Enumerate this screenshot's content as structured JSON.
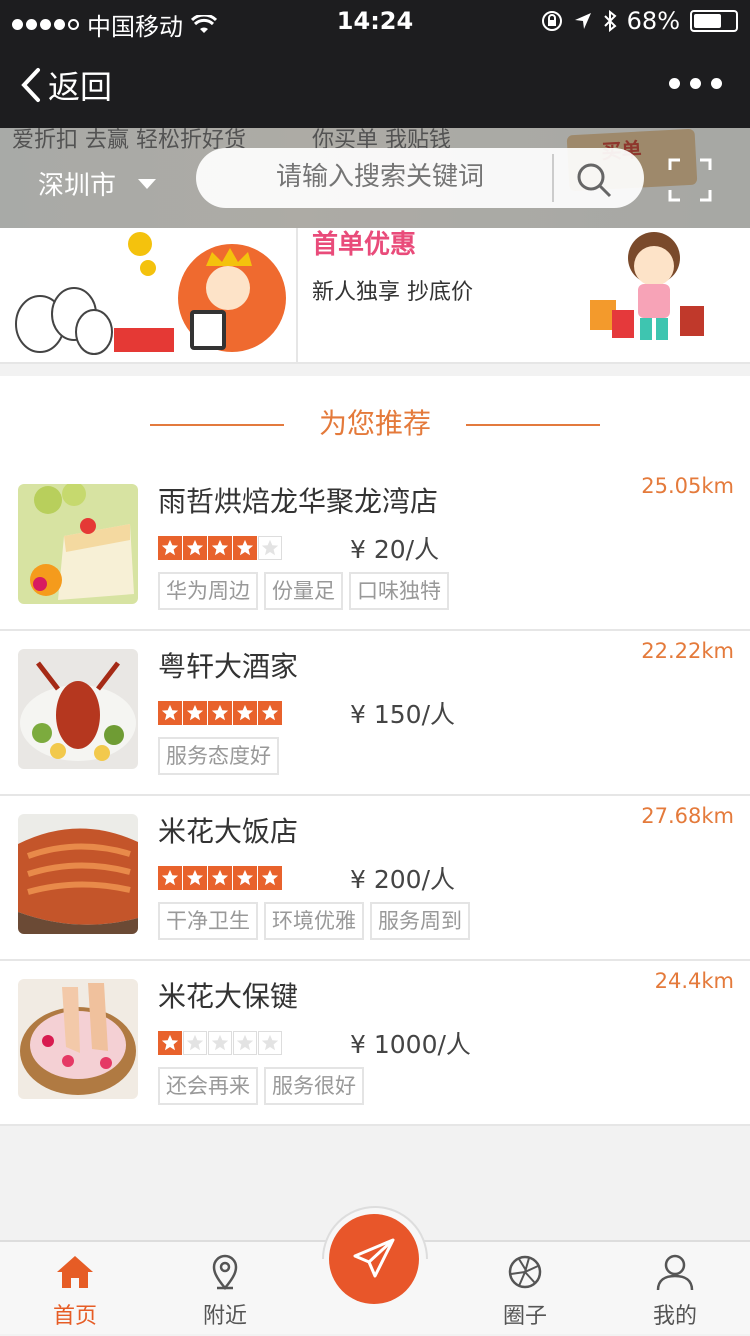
{
  "status": {
    "carrier": "中国移动",
    "time": "14:24",
    "battery": "68%",
    "battery_level": 0.68
  },
  "nav": {
    "back_label": "返回"
  },
  "banner": {
    "text_left": "爱折扣 去赢 轻松折好货",
    "text_right": "你买单 我贴钱",
    "sign": "买单"
  },
  "header": {
    "city": "深圳市",
    "search_placeholder": "请输入搜索关键词"
  },
  "promo": {
    "title": "首单优惠",
    "subtitle": "新人独享 抄底价"
  },
  "section": {
    "title": "为您推荐"
  },
  "items": [
    {
      "name": "雨哲烘焙龙华聚龙湾店",
      "distance": "25.05km",
      "rating": 4,
      "price": "¥ 20/人",
      "tags": [
        "华为周边",
        "份量足",
        "口味独特"
      ]
    },
    {
      "name": "粤轩大酒家",
      "distance": "22.22km",
      "rating": 5,
      "price": "¥ 150/人",
      "tags": [
        "服务态度好"
      ]
    },
    {
      "name": "米花大饭店",
      "distance": "27.68km",
      "rating": 5,
      "price": "¥ 200/人",
      "tags": [
        "干净卫生",
        "环境优雅",
        "服务周到"
      ]
    },
    {
      "name": "米花大保键",
      "distance": "24.4km",
      "rating": 1,
      "price": "¥ 1000/人",
      "tags": [
        "还会再来",
        "服务很好"
      ]
    }
  ],
  "tabs": [
    {
      "label": "首页",
      "icon": "home-icon",
      "active": true
    },
    {
      "label": "附近",
      "icon": "location-pin-icon",
      "active": false
    },
    {
      "label": "圈子",
      "icon": "aperture-icon",
      "active": false
    },
    {
      "label": "我的",
      "icon": "user-icon",
      "active": false
    }
  ],
  "colors": {
    "accent": "#e8562a",
    "distance": "#e47a3b",
    "promo_title": "#e94b7a",
    "bar": "#1d1d1f"
  }
}
